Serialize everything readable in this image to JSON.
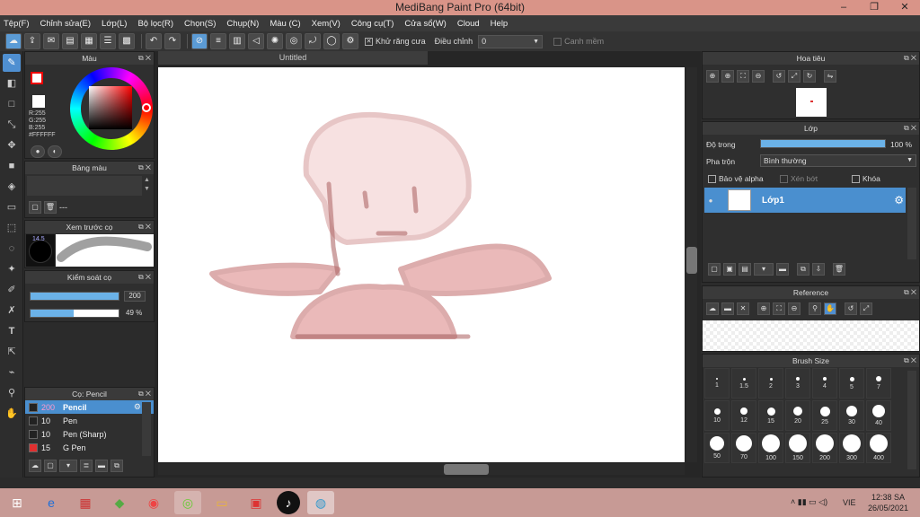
{
  "window": {
    "title": "MediBang Paint Pro (64bit)",
    "minimize": "–",
    "restore": "❐",
    "close": "✕"
  },
  "menu": [
    "Tệp(F)",
    "Chỉnh sửa(E)",
    "Lớp(L)",
    "Bộ lọc(R)",
    "Chọn(S)",
    "Chụp(N)",
    "Màu (C)",
    "Xem(V)",
    "Công cụ(T)",
    "Cửa sổ(W)",
    "Cloud",
    "Help"
  ],
  "toolbar": {
    "antialias_label": "Khử răng cưa",
    "adjust_label": "Điều chỉnh",
    "adjust_value": "0",
    "edge_label": "Canh mềm"
  },
  "color_panel": {
    "title": "Màu",
    "r": "R:255",
    "g": "G:255",
    "b": "B:255",
    "hex": "#FFFFFF"
  },
  "palette_panel": {
    "title": "Bảng màu",
    "dash": "---"
  },
  "brush_preview_panel": {
    "title": "Xem trước cọ",
    "size": "14.5"
  },
  "brush_control_panel": {
    "title": "Kiểm soát cọ",
    "size_value": "200",
    "opacity_value": "49 %",
    "opacity_fraction": 0.49
  },
  "brush_list_panel": {
    "title": "Cọ: Pencil",
    "items": [
      {
        "size": "200",
        "name": "Pencil",
        "color": "#222222"
      },
      {
        "size": "10",
        "name": "Pen",
        "color": "#222222"
      },
      {
        "size": "10",
        "name": "Pen (Sharp)",
        "color": "#222222"
      },
      {
        "size": "15",
        "name": "G Pen",
        "color": "#e03030"
      }
    ]
  },
  "canvas": {
    "tab_title": "Untitled"
  },
  "navigator_panel": {
    "title": "Hoa tiêu"
  },
  "layer_panel": {
    "title": "Lớp",
    "opacity_label": "Độ trong",
    "opacity_value": "100 %",
    "blend_label": "Pha trộn",
    "blend_value": "Bình thường",
    "protect_alpha": "Bảo vệ alpha",
    "clipping": "Xén bớt",
    "lock": "Khóa",
    "layer_name": "Lớp1"
  },
  "reference_panel": {
    "title": "Reference"
  },
  "brush_size_panel": {
    "title": "Brush Size",
    "sizes": [
      "1",
      "1.5",
      "2",
      "3",
      "4",
      "5",
      "7",
      "10",
      "12",
      "15",
      "20",
      "25",
      "30",
      "40",
      "50",
      "70",
      "100",
      "150",
      "200",
      "300",
      "400"
    ]
  },
  "taskbar": {
    "lang": "VIE",
    "time": "12:38 SA",
    "date": "26/05/2021"
  }
}
